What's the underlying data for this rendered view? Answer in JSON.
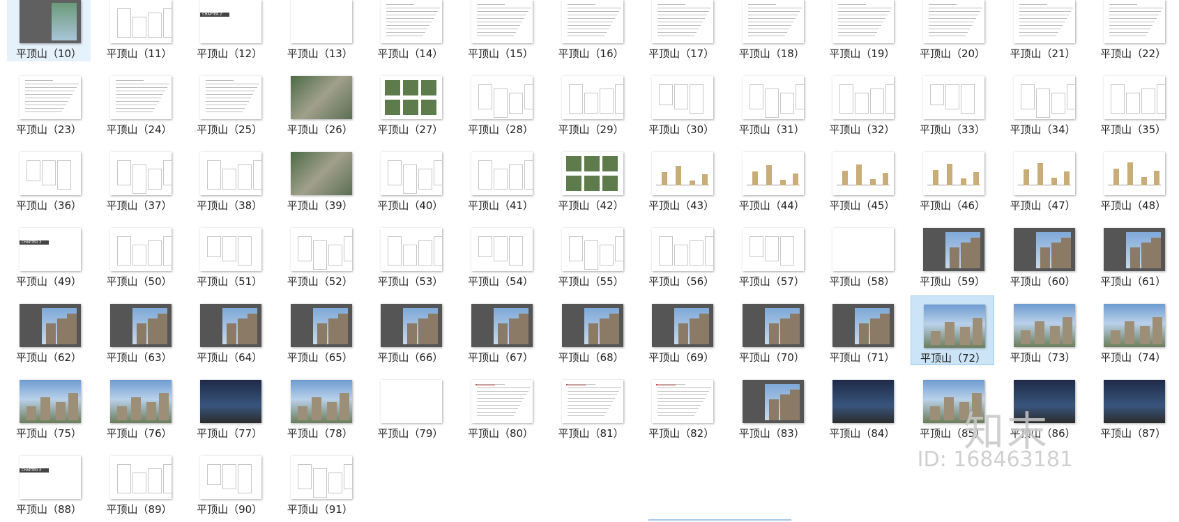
{
  "file_label_prefix": "平顶山",
  "selected_items": [
    10,
    72
  ],
  "items": [
    {
      "n": 10,
      "label": "平顶山（10）",
      "kind": "cover"
    },
    {
      "n": 11,
      "label": "平顶山（11）",
      "kind": "plan"
    },
    {
      "n": 12,
      "label": "平顶山（12）",
      "kind": "chapter",
      "chapter": "CHAPTER 2"
    },
    {
      "n": 13,
      "label": "平顶山（13）",
      "kind": "blank"
    },
    {
      "n": 14,
      "label": "平顶山（14）",
      "kind": "text"
    },
    {
      "n": 15,
      "label": "平顶山（15）",
      "kind": "text"
    },
    {
      "n": 16,
      "label": "平顶山（16）",
      "kind": "text"
    },
    {
      "n": 17,
      "label": "平顶山（17）",
      "kind": "text"
    },
    {
      "n": 18,
      "label": "平顶山（18）",
      "kind": "text"
    },
    {
      "n": 19,
      "label": "平顶山（19）",
      "kind": "text"
    },
    {
      "n": 20,
      "label": "平顶山（20）",
      "kind": "text"
    },
    {
      "n": 21,
      "label": "平顶山（21）",
      "kind": "text"
    },
    {
      "n": 22,
      "label": "平顶山（22）",
      "kind": "text"
    },
    {
      "n": 23,
      "label": "平顶山（23）",
      "kind": "text"
    },
    {
      "n": 24,
      "label": "平顶山（24）",
      "kind": "text"
    },
    {
      "n": 25,
      "label": "平顶山（25）",
      "kind": "text"
    },
    {
      "n": 26,
      "label": "平顶山（26）",
      "kind": "aerial"
    },
    {
      "n": 27,
      "label": "平顶山（27）",
      "kind": "green"
    },
    {
      "n": 28,
      "label": "平顶山（28）",
      "kind": "plan"
    },
    {
      "n": 29,
      "label": "平顶山（29）",
      "kind": "plan"
    },
    {
      "n": 30,
      "label": "平顶山（30）",
      "kind": "plan"
    },
    {
      "n": 31,
      "label": "平顶山（31）",
      "kind": "plan"
    },
    {
      "n": 32,
      "label": "平顶山（32）",
      "kind": "plan"
    },
    {
      "n": 33,
      "label": "平顶山（33）",
      "kind": "plan"
    },
    {
      "n": 34,
      "label": "平顶山（34）",
      "kind": "plan"
    },
    {
      "n": 35,
      "label": "平顶山（35）",
      "kind": "plan"
    },
    {
      "n": 36,
      "label": "平顶山（36）",
      "kind": "plan"
    },
    {
      "n": 37,
      "label": "平顶山（37）",
      "kind": "plan"
    },
    {
      "n": 38,
      "label": "平顶山（38）",
      "kind": "plan"
    },
    {
      "n": 39,
      "label": "平顶山（39）",
      "kind": "aerial"
    },
    {
      "n": 40,
      "label": "平顶山（40）",
      "kind": "plan"
    },
    {
      "n": 41,
      "label": "平顶山（41）",
      "kind": "plan"
    },
    {
      "n": 42,
      "label": "平顶山（42）",
      "kind": "green"
    },
    {
      "n": 43,
      "label": "平顶山（43）",
      "kind": "chart"
    },
    {
      "n": 44,
      "label": "平顶山（44）",
      "kind": "chart"
    },
    {
      "n": 45,
      "label": "平顶山（45）",
      "kind": "chart"
    },
    {
      "n": 46,
      "label": "平顶山（46）",
      "kind": "chart"
    },
    {
      "n": 47,
      "label": "平顶山（47）",
      "kind": "chart"
    },
    {
      "n": 48,
      "label": "平顶山（48）",
      "kind": "chart"
    },
    {
      "n": 49,
      "label": "平顶山（49）",
      "kind": "chapter",
      "chapter": "CHAPTER 3"
    },
    {
      "n": 50,
      "label": "平顶山（50）",
      "kind": "plan"
    },
    {
      "n": 51,
      "label": "平顶山（51）",
      "kind": "plan"
    },
    {
      "n": 52,
      "label": "平顶山（52）",
      "kind": "plan"
    },
    {
      "n": 53,
      "label": "平顶山（53）",
      "kind": "plan"
    },
    {
      "n": 54,
      "label": "平顶山（54）",
      "kind": "plan"
    },
    {
      "n": 55,
      "label": "平顶山（55）",
      "kind": "plan"
    },
    {
      "n": 56,
      "label": "平顶山（56）",
      "kind": "plan"
    },
    {
      "n": 57,
      "label": "平顶山（57）",
      "kind": "plan"
    },
    {
      "n": 58,
      "label": "平顶山（58）",
      "kind": "blank"
    },
    {
      "n": 59,
      "label": "平顶山（59）",
      "kind": "dark"
    },
    {
      "n": 60,
      "label": "平顶山（60）",
      "kind": "dark"
    },
    {
      "n": 61,
      "label": "平顶山（61）",
      "kind": "dark"
    },
    {
      "n": 62,
      "label": "平顶山（62）",
      "kind": "dark"
    },
    {
      "n": 63,
      "label": "平顶山（63）",
      "kind": "dark"
    },
    {
      "n": 64,
      "label": "平顶山（64）",
      "kind": "dark"
    },
    {
      "n": 65,
      "label": "平顶山（65）",
      "kind": "dark"
    },
    {
      "n": 66,
      "label": "平顶山（66）",
      "kind": "dark"
    },
    {
      "n": 67,
      "label": "平顶山（67）",
      "kind": "dark"
    },
    {
      "n": 68,
      "label": "平顶山（68）",
      "kind": "dark"
    },
    {
      "n": 69,
      "label": "平顶山（69）",
      "kind": "dark"
    },
    {
      "n": 70,
      "label": "平顶山（70）",
      "kind": "dark"
    },
    {
      "n": 71,
      "label": "平顶山（71）",
      "kind": "dark"
    },
    {
      "n": 72,
      "label": "平顶山（72）",
      "kind": "photo"
    },
    {
      "n": 73,
      "label": "平顶山（73）",
      "kind": "photo"
    },
    {
      "n": 74,
      "label": "平顶山（74）",
      "kind": "photo"
    },
    {
      "n": 75,
      "label": "平顶山（75）",
      "kind": "photo"
    },
    {
      "n": 76,
      "label": "平顶山（76）",
      "kind": "photo"
    },
    {
      "n": 77,
      "label": "平顶山（77）",
      "kind": "night"
    },
    {
      "n": 78,
      "label": "平顶山（78）",
      "kind": "photo"
    },
    {
      "n": 79,
      "label": "平顶山（79）",
      "kind": "blank"
    },
    {
      "n": 80,
      "label": "平顶山（80）",
      "kind": "red"
    },
    {
      "n": 81,
      "label": "平顶山（81）",
      "kind": "red"
    },
    {
      "n": 82,
      "label": "平顶山（82）",
      "kind": "red"
    },
    {
      "n": 83,
      "label": "平顶山（83）",
      "kind": "dark"
    },
    {
      "n": 84,
      "label": "平顶山（84）",
      "kind": "night"
    },
    {
      "n": 85,
      "label": "平顶山（85）",
      "kind": "photo"
    },
    {
      "n": 86,
      "label": "平顶山（86）",
      "kind": "night"
    },
    {
      "n": 87,
      "label": "平顶山（87）",
      "kind": "night"
    },
    {
      "n": 88,
      "label": "平顶山（88）",
      "kind": "chapter",
      "chapter": "CHAPTER 4"
    },
    {
      "n": 89,
      "label": "平顶山（89）",
      "kind": "plan"
    },
    {
      "n": 90,
      "label": "平顶山（90）",
      "kind": "plan"
    },
    {
      "n": 91,
      "label": "平顶山（91）",
      "kind": "plan"
    }
  ],
  "watermark": {
    "logo": "知末",
    "id": "ID: 168463181"
  }
}
